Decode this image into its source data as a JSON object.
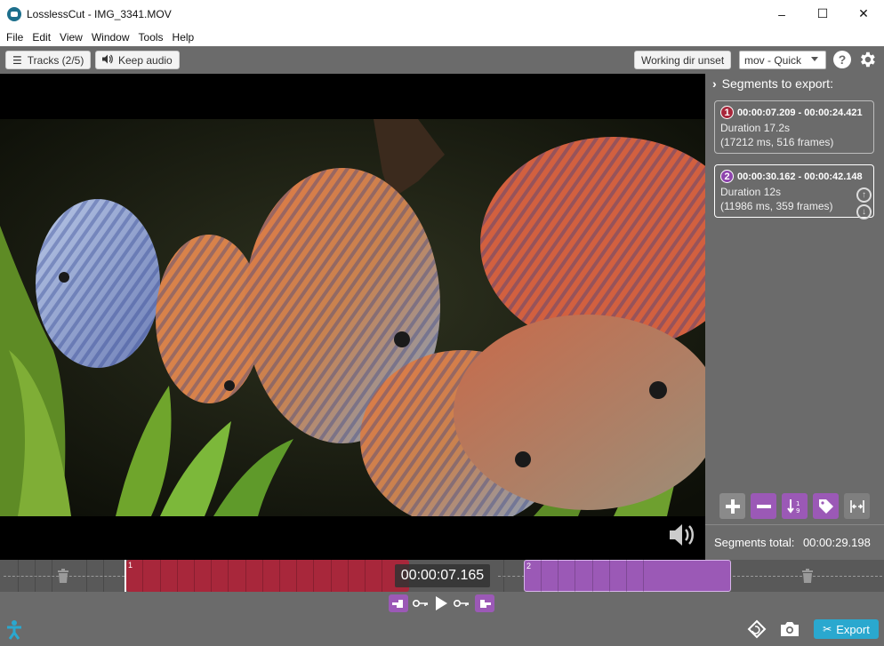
{
  "window": {
    "title": "LosslessCut - IMG_3341.MOV",
    "minimize": "–",
    "maximize": "☐",
    "close": "✕"
  },
  "menu": [
    "File",
    "Edit",
    "View",
    "Window",
    "Tools",
    "Help"
  ],
  "toolbar": {
    "tracks_label": "Tracks (2/5)",
    "keep_audio_label": "Keep audio",
    "working_dir_label": "Working dir unset",
    "format_value": "mov - Quick",
    "help_label": "?"
  },
  "panel": {
    "header": "Segments to export:",
    "segments": [
      {
        "number": "1",
        "range": "00:00:07.209 - 00:00:24.421",
        "duration": "Duration 17.2s",
        "detail": "(17212 ms, 516 frames)",
        "color": "#a8273b"
      },
      {
        "number": "2",
        "range": "00:00:30.162 - 00:00:42.148",
        "duration": "Duration 12s",
        "detail": "(11986 ms, 359 frames)",
        "color": "#8e44ad"
      }
    ],
    "tools": [
      {
        "icon": "plus-icon",
        "color": "#8a8a8a"
      },
      {
        "icon": "minus-icon",
        "color": "#9b59b6"
      },
      {
        "icon": "sort-icon",
        "color": "#9b59b6"
      },
      {
        "icon": "tag-icon",
        "color": "#9b59b6"
      },
      {
        "icon": "merge-icon",
        "color": "#7f7f7f"
      }
    ],
    "total_label": "Segments total:",
    "total_value": "00:00:29.198"
  },
  "timeline": {
    "current_time": "00:00:07.165",
    "segments": [
      {
        "label": "1",
        "color": "#a8273b"
      },
      {
        "label": "2",
        "color": "#9b59b6"
      }
    ]
  },
  "controls": {
    "export_label": "Export",
    "accent": "#2aa8cf"
  }
}
